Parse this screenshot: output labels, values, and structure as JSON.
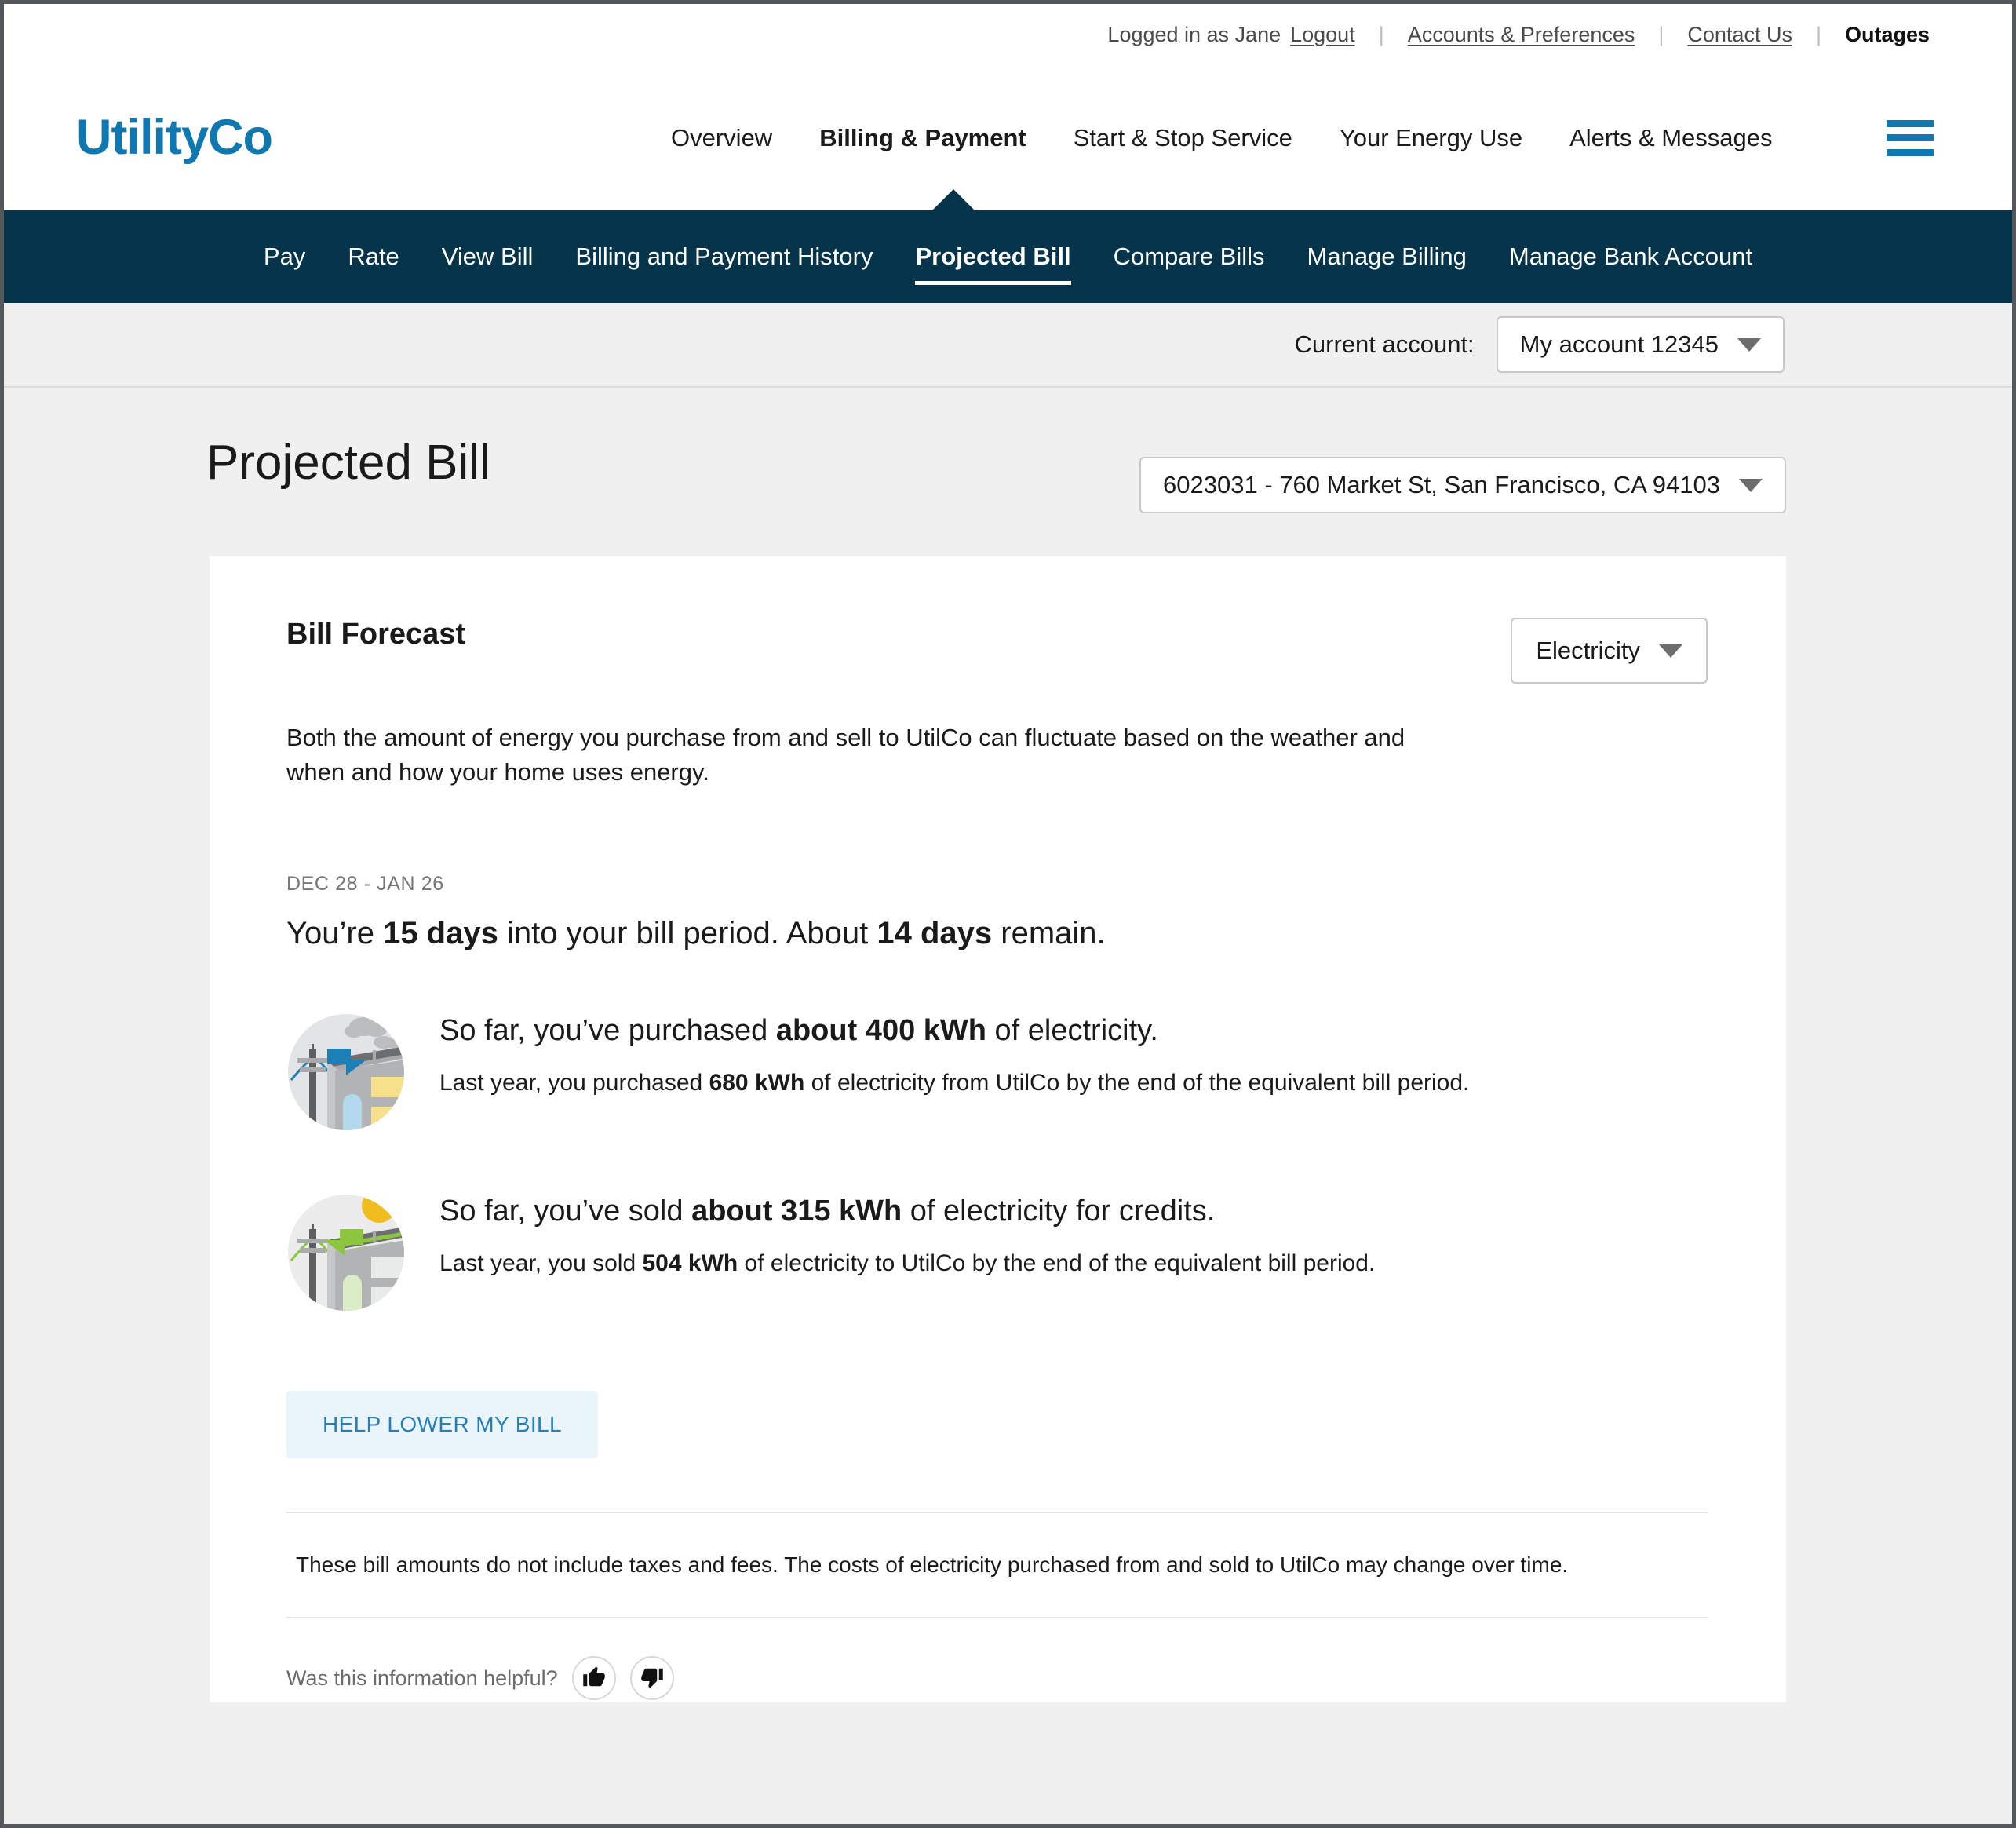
{
  "utility_bar": {
    "logged_in_text": "Logged in as Jane",
    "logout_label": "Logout",
    "links": [
      {
        "label": "Accounts & Preferences",
        "style": "underline"
      },
      {
        "label": "Contact Us",
        "style": "underline"
      },
      {
        "label": "Outages",
        "style": "bold"
      }
    ],
    "separator": "|"
  },
  "header": {
    "logo_text": "UtilityCo",
    "logo_color": "#1078b0",
    "menu_icon": "hamburger-icon",
    "nav": [
      {
        "label": "Overview",
        "active": false
      },
      {
        "label": "Billing & Payment",
        "active": true
      },
      {
        "label": "Start & Stop Service",
        "active": false
      },
      {
        "label": "Your Energy Use",
        "active": false
      },
      {
        "label": "Alerts & Messages",
        "active": false
      }
    ]
  },
  "subnav": {
    "background": "#05344b",
    "items": [
      {
        "label": "Pay",
        "active": false
      },
      {
        "label": "Rate",
        "active": false
      },
      {
        "label": "View Bill",
        "active": false
      },
      {
        "label": "Billing and Payment History",
        "active": false
      },
      {
        "label": "Projected Bill",
        "active": true
      },
      {
        "label": "Compare Bills",
        "active": false
      },
      {
        "label": "Manage Billing",
        "active": false
      },
      {
        "label": "Manage Bank Account",
        "active": false
      }
    ]
  },
  "account_strip": {
    "label": "Current account:",
    "selected_account": "My account 12345"
  },
  "page": {
    "title": "Projected Bill",
    "address_selected": "6023031 - 760 Market St, San Francisco, CA 94103"
  },
  "card": {
    "title": "Bill Forecast",
    "fuel_selected": "Electricity",
    "intro": "Both the amount of energy you purchase from and sell to UtilCo can fluctuate based on the weather and when and how your home uses energy.",
    "period_label": "DEC 28 - JAN 26",
    "period_line": {
      "prefix": "You’re ",
      "days_in": "15 days",
      "middle": " into your bill period. About ",
      "days_remain": "14 days",
      "suffix": " remain."
    },
    "facts": [
      {
        "icon": "energy-purchased-icon",
        "main_prefix": "So far, you’ve purchased ",
        "main_value": "about 400 kWh",
        "main_suffix": " of electricity.",
        "sub_prefix": "Last year, you purchased ",
        "sub_value": "680 kWh",
        "sub_suffix": " of electricity from UtilCo by the end of the equivalent bill period."
      },
      {
        "icon": "energy-sold-icon",
        "main_prefix": "So far, you’ve sold ",
        "main_value": "about 315 kWh",
        "main_suffix": " of electricity for credits.",
        "sub_prefix": "Last year, you sold ",
        "sub_value": "504 kWh",
        "sub_suffix": " of electricity to UtilCo by the end of the equivalent bill period."
      }
    ],
    "cta_label": "HELP LOWER MY BILL",
    "cta_color": "#2680b8",
    "disclaimer": "These bill amounts do not include taxes and fees. The costs of electricity purchased from and sold to UtilCo may change over time.",
    "feedback_question": "Was this information helpful?",
    "thumb_up_icon": "thumbs-up-icon",
    "thumb_down_icon": "thumbs-down-icon"
  }
}
